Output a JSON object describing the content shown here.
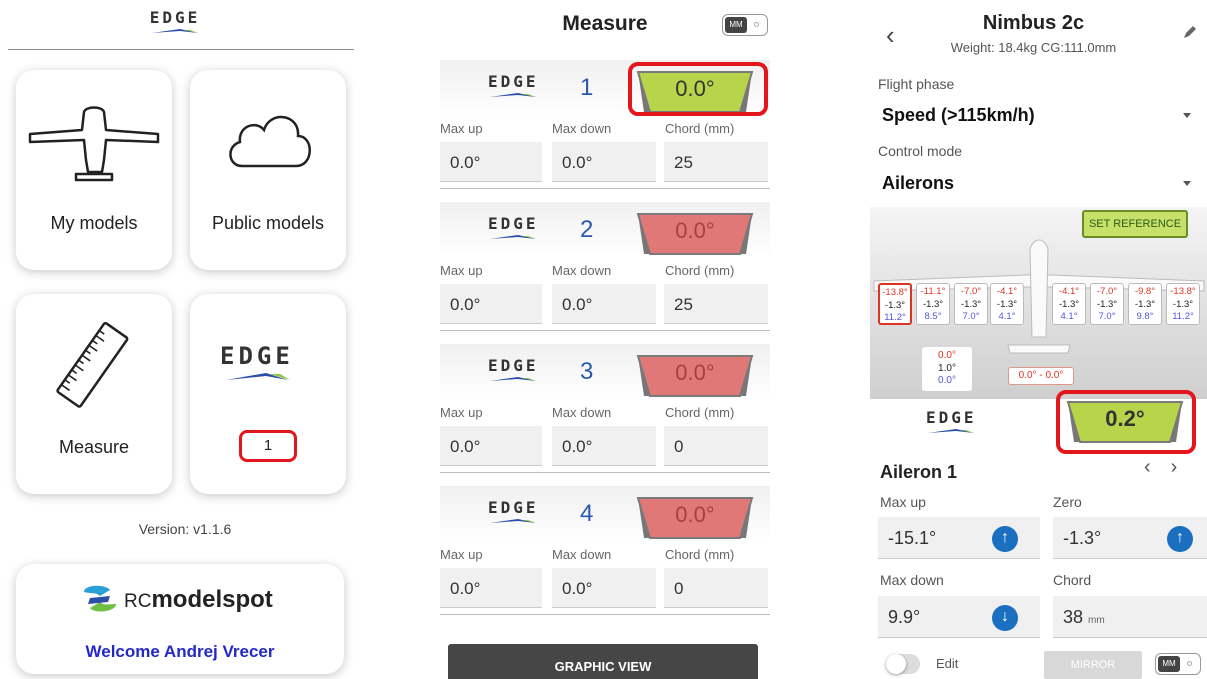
{
  "brand": {
    "edge_logo": "EDGE"
  },
  "screen1": {
    "tiles": [
      {
        "label": "My models",
        "icon": "airplane-icon"
      },
      {
        "label": "Public models",
        "icon": "cloud-icon"
      },
      {
        "label": "Measure",
        "icon": "ruler-icon"
      },
      {
        "label": "1",
        "icon": "edge-logo"
      }
    ],
    "version": "Version: v1.1.6",
    "rcmodelspot": {
      "brand_prefix": "RC",
      "brand_rest": "modelspot",
      "welcome": "Welcome Andrej Vrecer"
    }
  },
  "screen2": {
    "title": "Measure",
    "toggle_label": "MM",
    "field_labels": {
      "max_up": "Max up",
      "max_down": "Max down",
      "chord": "Chord (mm)"
    },
    "units": [
      {
        "number": "1",
        "angle": "0.0°",
        "state": "green",
        "max_up": "0.0°",
        "max_down": "0.0°",
        "chord": "25"
      },
      {
        "number": "2",
        "angle": "0.0°",
        "state": "red",
        "max_up": "0.0°",
        "max_down": "0.0°",
        "chord": "25"
      },
      {
        "number": "3",
        "angle": "0.0°",
        "state": "red",
        "max_up": "0.0°",
        "max_down": "0.0°",
        "chord": "0"
      },
      {
        "number": "4",
        "angle": "0.0°",
        "state": "red",
        "max_up": "0.0°",
        "max_down": "0.0°",
        "chord": "0"
      }
    ],
    "graphic_view_label": "GRAPHIC VIEW"
  },
  "screen3": {
    "model_name": "Nimbus 2c",
    "model_info": "Weight: 18.4kg  CG:111.0mm",
    "flight_phase_label": "Flight phase",
    "flight_phase_value": "Speed (>115km/h)",
    "control_mode_label": "Control mode",
    "control_mode_value": "Ailerons",
    "set_reference_label": "SET REFERENCE",
    "surfaces": [
      {
        "top": "-13.8°",
        "mid": "-1.3°",
        "bot": "11.2°"
      },
      {
        "top": "-11.1°",
        "mid": "-1.3°",
        "bot": "8.5°"
      },
      {
        "top": "-7.0°",
        "mid": "-1.3°",
        "bot": "7.0°"
      },
      {
        "top": "-4.1°",
        "mid": "-1.3°",
        "bot": "4.1°"
      },
      {
        "top": "-4.1°",
        "mid": "-1.3°",
        "bot": "4.1°"
      },
      {
        "top": "-7.0°",
        "mid": "-1.3°",
        "bot": "7.0°"
      },
      {
        "top": "-9.8°",
        "mid": "-1.3°",
        "bot": "9.8°"
      },
      {
        "top": "-13.8°",
        "mid": "-1.3°",
        "bot": "11.2°"
      }
    ],
    "elevator": {
      "top": "0.0°",
      "mid": "1.0°",
      "bot": "0.0°"
    },
    "rudder": "0.0° - 0.0°",
    "angle": "0.2°",
    "surface_title": "Aileron 1",
    "nav_prev": "‹",
    "nav_next": "›",
    "fields": {
      "max_up_label": "Max up",
      "max_up_value": "-15.1°",
      "zero_label": "Zero",
      "zero_value": "-1.3°",
      "max_down_label": "Max down",
      "max_down_value": "9.9°",
      "chord_label": "Chord",
      "chord_value": "38",
      "chord_unit": "mm"
    },
    "edit_label": "Edit",
    "mirror_label": "MIRROR",
    "toggle_label": "MM"
  }
}
